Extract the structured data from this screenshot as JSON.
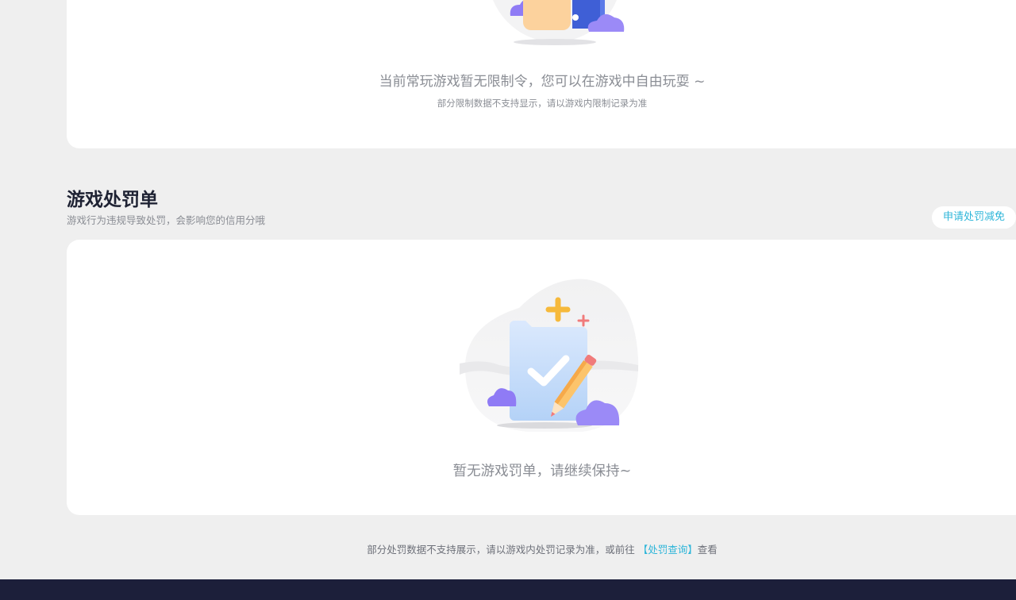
{
  "restriction": {
    "main_text": "当前常玩游戏暂无限制令，您可以在游戏中自由玩耍 ~",
    "sub_text": "部分限制数据不支持显示，请以游戏内限制记录为准"
  },
  "penalty": {
    "title": "游戏处罚单",
    "description": "游戏行为违规导致处罚，会影响您的信用分哦",
    "appeal_button": "申请处罚减免",
    "empty_text": "暂无游戏罚单，请继续保持~"
  },
  "footer": {
    "note_prefix": "部分处罚数据不支持展示，请以游戏内处罚记录为准，或前往 ",
    "link_text": "【处罚查询】",
    "note_suffix": "查看"
  },
  "icons": {
    "restriction_illustration": "empty-restriction-illustration",
    "penalty_illustration": "folder-check-pencil-illustration"
  },
  "colors": {
    "background": "#efefef",
    "card": "#ffffff",
    "accent": "#2fb6d9",
    "title": "#1e2233",
    "muted_text": "#8a8d94",
    "footer_bar": "#1c1f3a"
  }
}
